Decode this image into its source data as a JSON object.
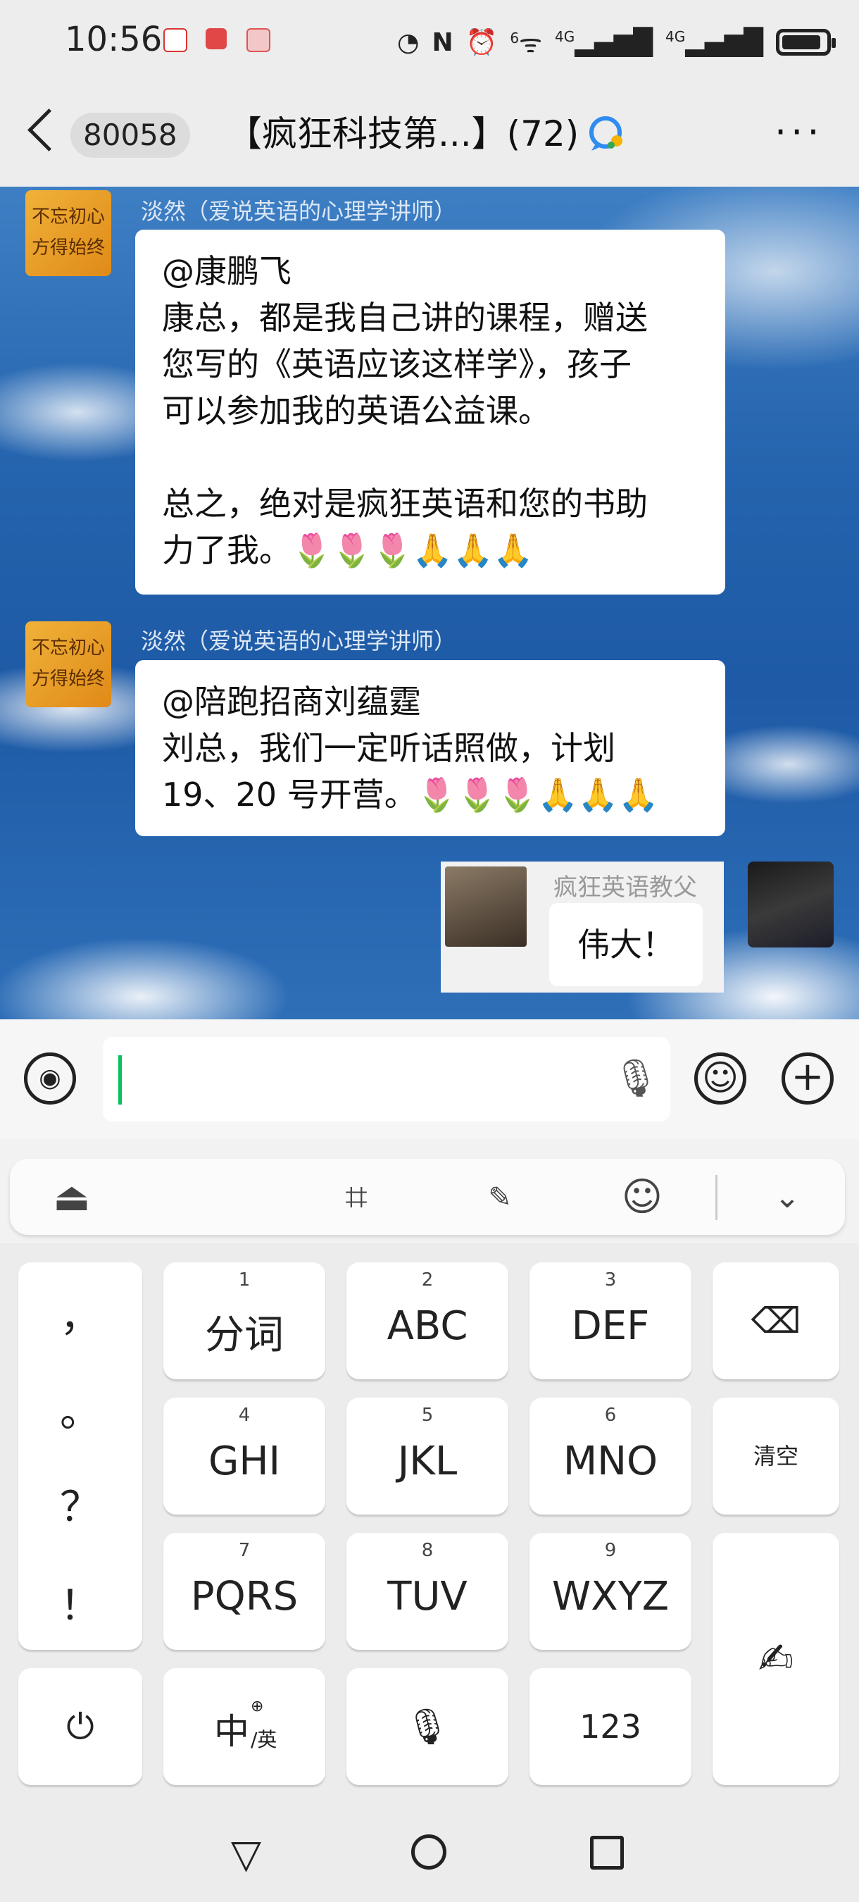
{
  "status_bar": {
    "time": "10:56",
    "icons": [
      "nfc-icon",
      "alarm-icon",
      "wifi-icon",
      "signal-4g-icon",
      "signal-4g-icon",
      "battery-icon"
    ],
    "network_labels": [
      "4G",
      "4G"
    ],
    "wifi_label": "6"
  },
  "nav": {
    "back_count": "80058",
    "title": "【疯狂科技第...】(72)"
  },
  "messages": [
    {
      "sender": "淡然（爱说英语的心理学讲师）",
      "avatar_text": "不忘初心\n方得始终",
      "text": "@康鹏飞\n康总，都是我自己讲的课程，赠送\n您写的《英语应该这样学》，孩子\n可以参加我的英语公益课。\n\n总之，绝对是疯狂英语和您的书助\n力了我。🌷🌷🌷🙏🙏🙏"
    },
    {
      "sender": "淡然（爱说英语的心理学讲师）",
      "avatar_text": "不忘初心\n方得始终",
      "text": "@陪跑招商刘蕴霆\n刘总，我们一定听话照做，计划\n19、20 号开营。🌷🌷🌷🙏🙏🙏"
    }
  ],
  "quoted": {
    "sender": "疯狂英语教父",
    "text": "伟大！"
  },
  "input": {
    "placeholder": ""
  },
  "ime_toolbar": [
    "keyboard-collapse-icon",
    "brush-icon",
    "ai-write-icon",
    "emoji-icon",
    "chevron-down-icon"
  ],
  "keyboard": {
    "punctuation": [
      "，",
      "。",
      "？",
      "！"
    ],
    "keys": [
      {
        "num": "1",
        "label": "分词"
      },
      {
        "num": "2",
        "label": "ABC"
      },
      {
        "num": "3",
        "label": "DEF"
      },
      {
        "num": "4",
        "label": "GHI"
      },
      {
        "num": "5",
        "label": "JKL"
      },
      {
        "num": "6",
        "label": "MNO"
      },
      {
        "num": "7",
        "label": "PQRS"
      },
      {
        "num": "8",
        "label": "TUV"
      },
      {
        "num": "9",
        "label": "WXYZ"
      }
    ],
    "clear_label": "清空",
    "lang_label": "中",
    "lang_sub": "/英",
    "num_label": "123"
  }
}
